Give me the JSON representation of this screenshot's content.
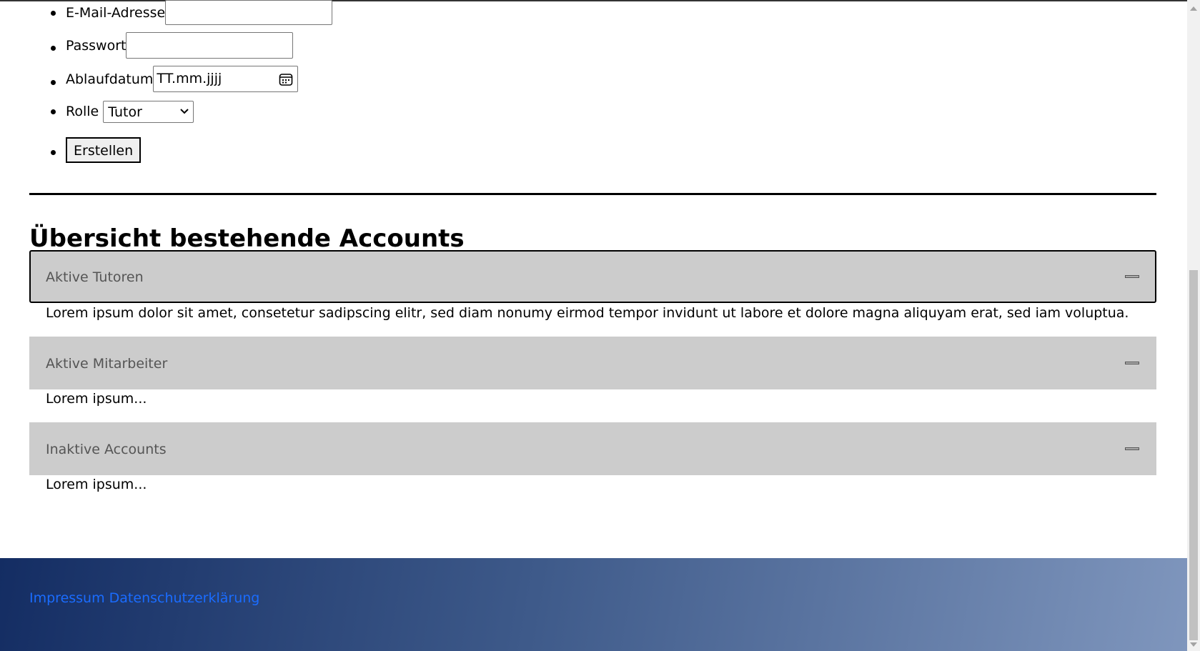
{
  "form": {
    "email_label": "E-Mail-Adresse",
    "email_value": "",
    "password_label": "Passwort",
    "password_value": "",
    "expiry_label": "Ablaufdatum",
    "expiry_placeholder": "TT.mm.jjjj",
    "role_label": "Rolle",
    "role_selected": "Tutor",
    "submit_label": "Erstellen"
  },
  "overview": {
    "title": "Übersicht bestehende Accounts",
    "sections": [
      {
        "title": "Aktive Tutoren",
        "content": "Lorem ipsum dolor sit amet, consetetur sadipscing elitr, sed diam nonumy eirmod tempor invidunt ut labore et dolore magna aliquyam erat, sed iam voluptua."
      },
      {
        "title": "Aktive Mitarbeiter",
        "content": "Lorem ipsum..."
      },
      {
        "title": "Inaktive Accounts",
        "content": "Lorem ipsum..."
      }
    ]
  },
  "footer": {
    "impressum": "Impressum",
    "datenschutz": "Datenschutzerklärung"
  },
  "colors": {
    "accordion_bg": "#cccccc",
    "footer_gradient_start": "#142d63",
    "footer_gradient_end": "#7f96bd",
    "link": "#1a6cff"
  }
}
